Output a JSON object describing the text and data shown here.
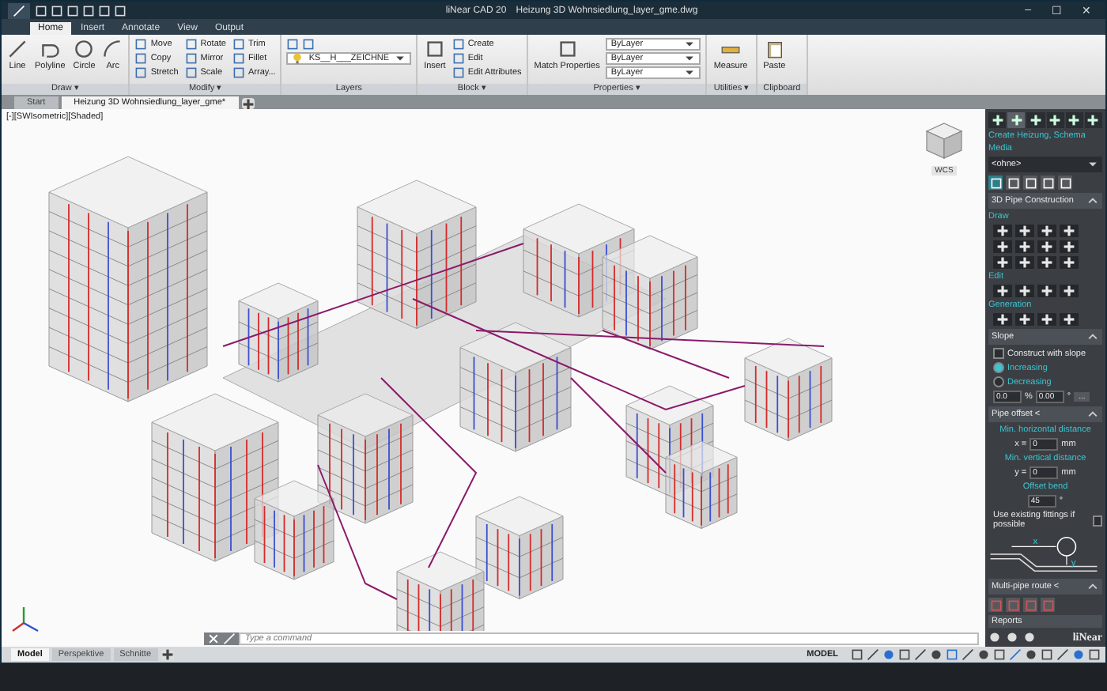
{
  "window": {
    "app_name": "liNear CAD 20",
    "title": "Heizung 3D Wohnsiedlung_layer_gme.dwg",
    "controls": [
      "–",
      "☐",
      "✕"
    ]
  },
  "ribbon": {
    "tabs": [
      {
        "label": "Home",
        "selected": true
      },
      {
        "label": "Insert",
        "selected": false
      },
      {
        "label": "Annotate",
        "selected": false
      },
      {
        "label": "View",
        "selected": false
      },
      {
        "label": "Output",
        "selected": false
      }
    ],
    "panels": [
      {
        "title": "Draw ▾",
        "large": [
          "Line",
          "Polyline",
          "Circle",
          "Arc"
        ]
      },
      {
        "title": "Modify ▾",
        "small": [
          "Move",
          "Rotate",
          "Trim",
          "Copy",
          "Mirror",
          "Fillet",
          "Stretch",
          "Scale",
          "Array..."
        ]
      },
      {
        "title": "Layers",
        "dropdowns": [
          "KS__H___ZEICHNE"
        ]
      },
      {
        "title": "Block ▾",
        "large": [
          "Insert"
        ],
        "small": [
          "Create",
          "Edit",
          "Edit Attributes"
        ]
      },
      {
        "title": "Properties ▾",
        "large": [
          "Match Properties"
        ],
        "dropdowns": [
          "ByLayer",
          "ByLayer",
          "ByLayer"
        ]
      },
      {
        "title": "Utilities ▾",
        "large": [
          "Measure"
        ]
      },
      {
        "title": "Clipboard",
        "large": [
          "Paste"
        ]
      }
    ]
  },
  "doc_tabs": [
    {
      "label": "Start",
      "selected": false
    },
    {
      "label": "Heizung 3D Wohnsiedlung_layer_gme*",
      "selected": true
    }
  ],
  "viewport": {
    "label": "[-][SWIsometric][Shaded]",
    "cube_label": "WCS"
  },
  "command_line": {
    "placeholder": "Type a command"
  },
  "layout_tabs": [
    {
      "label": "Model",
      "selected": true
    },
    {
      "label": "Perspektive",
      "selected": false
    },
    {
      "label": "Schnitte",
      "selected": false
    }
  ],
  "status_bar": {
    "mode": "MODEL"
  },
  "tool_panel": {
    "tabs": [
      {
        "selected": false
      },
      {
        "selected": true
      },
      {
        "selected": false
      },
      {
        "selected": false
      },
      {
        "selected": false
      },
      {
        "selected": false
      }
    ],
    "title": "Create Heizung, Schema",
    "media_label": "Media",
    "media_value": "<ohne>",
    "modes": [
      {
        "selected": true
      },
      {
        "selected": false
      },
      {
        "selected": false
      },
      {
        "selected": false
      },
      {
        "selected": false
      }
    ],
    "section": "3D Pipe Construction",
    "groups": [
      {
        "label": "Draw"
      },
      {
        "label": "Edit"
      },
      {
        "label": "Generation"
      }
    ],
    "slope": {
      "title": "Slope",
      "construct": {
        "label": "Construct with slope",
        "checked": false
      },
      "options": [
        {
          "label": "Increasing",
          "selected": true
        },
        {
          "label": "Decreasing",
          "selected": false
        }
      ],
      "fields": [
        {
          "value": "0.0",
          "unit": "%"
        },
        {
          "value": "0.00",
          "unit": "°"
        }
      ],
      "more": "..."
    },
    "pipe_offset": {
      "title": "Pipe offset <",
      "horizontal_label": "Min. horizontal distance",
      "x_label": "x =",
      "x_value": "0",
      "x_unit": "mm",
      "vertical_label": "Min. vertical distance",
      "y_label": "y =",
      "y_value": "0",
      "y_unit": "mm",
      "bend_label": "Offset bend",
      "bend_value": "45",
      "bend_unit": "°",
      "fittings": {
        "label": "Use existing fittings if possible",
        "checked": false
      },
      "diagram_x": "x",
      "diagram_y": "y"
    },
    "multi_pipe": "Multi-pipe route <",
    "reports": "Reports",
    "brand": "liNear"
  }
}
